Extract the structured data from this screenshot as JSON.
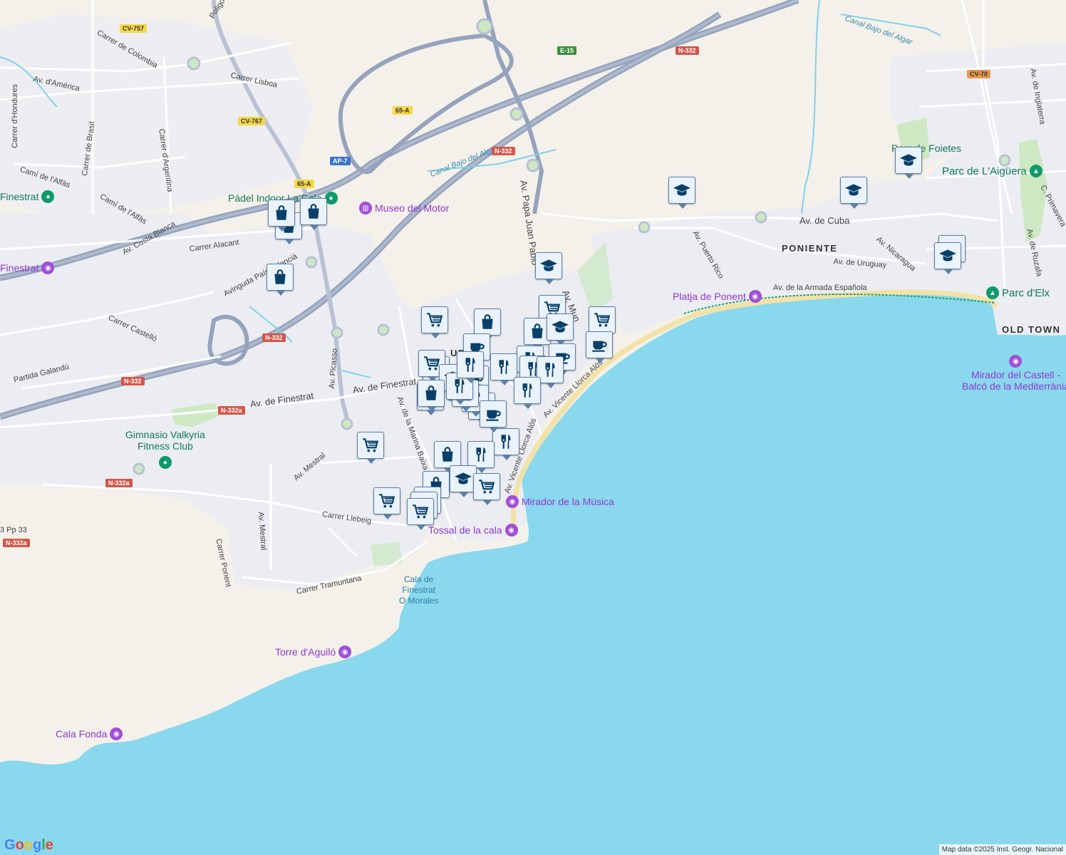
{
  "colors": {
    "water": "#8ad8ee",
    "land": "#f4f1ea",
    "urban": "#ecedf2",
    "road": "#ffffff",
    "highway": "#95a3bd",
    "marker_bg": "#eaf2fb",
    "marker_icon": "#08406a",
    "green_poi": "#0e7a5a",
    "purple_poi": "#8e3ad0"
  },
  "roads": [
    {
      "id": "r1",
      "text": "Poligono Plana"
    },
    {
      "id": "r2",
      "text": "CV-757"
    },
    {
      "id": "r3",
      "text": "Carrer de Colombia"
    },
    {
      "id": "r4",
      "text": "Av. d'América"
    },
    {
      "id": "r5",
      "text": "Carrer Lisboa"
    },
    {
      "id": "r6",
      "text": "Carrer d'Hondures"
    },
    {
      "id": "r7",
      "text": "Carrer de Brasil"
    },
    {
      "id": "r8",
      "text": "Carrer d'Argentina"
    },
    {
      "id": "r9",
      "text": "Camí de l'Alfàs"
    },
    {
      "id": "r10",
      "text": "Camí de l'Alfàs"
    },
    {
      "id": "r11",
      "text": "Av. Costa Blanca"
    },
    {
      "id": "r12",
      "text": "Carrer Alacant"
    },
    {
      "id": "r13",
      "text": "Avinguda País Valencià"
    },
    {
      "id": "r14",
      "text": "Carrer Castelló"
    },
    {
      "id": "r15",
      "text": "Partida Galandú"
    },
    {
      "id": "r16",
      "text": "Av. Picasso"
    },
    {
      "id": "r17",
      "text": "Av. de Finestrat"
    },
    {
      "id": "r18",
      "text": "Av. de Finestrat"
    },
    {
      "id": "r19",
      "text": "Av. de la Marina Baixa"
    },
    {
      "id": "r20",
      "text": "Av. Mestral"
    },
    {
      "id": "r21",
      "text": "Av. Mestral"
    },
    {
      "id": "r22",
      "text": "Carrer Llebeig"
    },
    {
      "id": "r23",
      "text": "Carrer Ponent"
    },
    {
      "id": "r24",
      "text": "Carrer Tramuntana"
    },
    {
      "id": "r25",
      "text": "Canal Bajo del Algar"
    },
    {
      "id": "r26",
      "text": "Canal Bajo del Algar"
    },
    {
      "id": "r27",
      "text": "Av. Papa Juan Pablo"
    },
    {
      "id": "r28",
      "text": "Av. Mun"
    },
    {
      "id": "r29",
      "text": "Av. de Cuba"
    },
    {
      "id": "r30",
      "text": "Av. Puerto Rico"
    },
    {
      "id": "r31",
      "text": "Av. Nicaragua"
    },
    {
      "id": "r32",
      "text": "Av. de Uruguay"
    },
    {
      "id": "r33",
      "text": "Av. de la Armada Española"
    },
    {
      "id": "r34",
      "text": "Av. Vicente Llorca Alós"
    },
    {
      "id": "r35",
      "text": "Av. Vicente Llorca Alós"
    },
    {
      "id": "r36",
      "text": "Av. de Inglaterra"
    },
    {
      "id": "r37",
      "text": "Av. de Ruzafa"
    },
    {
      "id": "r38",
      "text": "C. Primavera"
    },
    {
      "id": "r39",
      "text": "3 Pp 33"
    }
  ],
  "shields": [
    {
      "id": "s1",
      "text": "CV-757",
      "kind": "yellow"
    },
    {
      "id": "s2",
      "text": "CV-767",
      "kind": "yellow"
    },
    {
      "id": "s3",
      "text": "65-A",
      "kind": "yellow"
    },
    {
      "id": "s4",
      "text": "AP-7",
      "kind": "blue"
    },
    {
      "id": "s5",
      "text": "65-A",
      "kind": "yellow"
    },
    {
      "id": "s6",
      "text": "E-15",
      "kind": "green"
    },
    {
      "id": "s7",
      "text": "N-332",
      "kind": "red"
    },
    {
      "id": "s8",
      "text": "N-332",
      "kind": "red"
    },
    {
      "id": "s9",
      "text": "N-332",
      "kind": "red"
    },
    {
      "id": "s10",
      "text": "N-332",
      "kind": "red"
    },
    {
      "id": "s11",
      "text": "N-332a",
      "kind": "red"
    },
    {
      "id": "s12",
      "text": "N-332a",
      "kind": "red"
    },
    {
      "id": "s13",
      "text": "N-332a",
      "kind": "red"
    },
    {
      "id": "s14",
      "text": "CV-70",
      "kind": "orange"
    }
  ],
  "places": [
    {
      "id": "pl1",
      "text": "PONIENTE"
    },
    {
      "id": "pl2",
      "text": "OLD TOWN"
    },
    {
      "id": "pl3",
      "text": "UR"
    }
  ],
  "pois_green": [
    {
      "id": "g1",
      "text": "Pádel Indoor La Cala"
    },
    {
      "id": "g2",
      "text": "Finestrat"
    },
    {
      "id": "g3",
      "text": "Parc de L'Aigüera"
    },
    {
      "id": "g4",
      "text": "Parc d'Elx"
    },
    {
      "id": "g5",
      "text": "Parc de Foietes"
    }
  ],
  "gym": {
    "line1": "Gimnasio Valkyria",
    "line2": "Fitness Club"
  },
  "pois_purple": [
    {
      "id": "p1",
      "text": "Museo del Motor"
    },
    {
      "id": "p2",
      "text": "Finestrat"
    },
    {
      "id": "p3",
      "text": "Platja de Ponent"
    },
    {
      "id": "p4",
      "text": "Mirador de la Música"
    },
    {
      "id": "p5",
      "text": "Tossal de la cala"
    },
    {
      "id": "p6",
      "text": "Torre d'Aguiló"
    },
    {
      "id": "p7",
      "text": "Cala Fonda"
    }
  ],
  "mirador": {
    "line1": "Mirador del Castell -",
    "line2": "Balcó de la Mediterrània"
  },
  "cala": {
    "line1": "Cala de",
    "line2": "Finestrat",
    "line3": "O Morales"
  },
  "markers": [
    {
      "type": "shopping-bag"
    },
    {
      "type": "shopping-bag"
    },
    {
      "type": "shopping-bag"
    },
    {
      "type": "shopping-bag"
    },
    {
      "type": "school"
    },
    {
      "type": "school"
    },
    {
      "type": "school"
    },
    {
      "type": "school"
    },
    {
      "type": "school"
    },
    {
      "type": "cart"
    },
    {
      "type": "shopping-bag"
    },
    {
      "type": "school"
    },
    {
      "type": "cart"
    },
    {
      "type": "cart"
    },
    {
      "type": "coffee"
    },
    {
      "type": "shopping-bag"
    },
    {
      "type": "school"
    },
    {
      "type": "coffee"
    },
    {
      "type": "restaurant"
    },
    {
      "type": "coffee"
    },
    {
      "type": "restaurant"
    },
    {
      "type": "cart"
    },
    {
      "type": "coffee"
    },
    {
      "type": "cart"
    },
    {
      "type": "shopping-bag"
    },
    {
      "type": "school"
    },
    {
      "type": "coffee"
    },
    {
      "type": "restaurant"
    },
    {
      "type": "restaurant"
    },
    {
      "type": "restaurant"
    },
    {
      "type": "restaurant"
    },
    {
      "type": "restaurant"
    },
    {
      "type": "restaurant"
    },
    {
      "type": "shopping-bag"
    },
    {
      "type": "coffee"
    },
    {
      "type": "restaurant"
    },
    {
      "type": "coffee"
    },
    {
      "type": "cart"
    },
    {
      "type": "shopping-bag"
    },
    {
      "type": "restaurant"
    },
    {
      "type": "restaurant"
    },
    {
      "type": "school"
    },
    {
      "type": "shopping-bag"
    },
    {
      "type": "cart"
    },
    {
      "type": "cart"
    },
    {
      "type": "cart"
    },
    {
      "type": "cart"
    },
    {
      "type": "cart"
    }
  ],
  "attribution": "Map data ©2025 Inst. Geogr. Nacional",
  "logo": "Google"
}
